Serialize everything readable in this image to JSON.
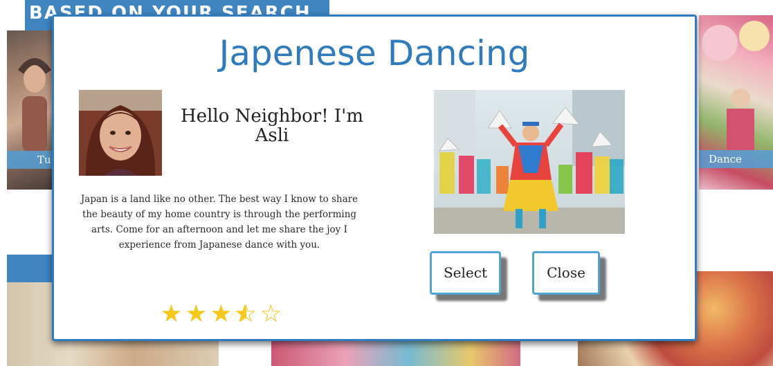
{
  "background": {
    "banner_top": "BASED ON YOUR SEARCH",
    "tile_left_caption": "Tu",
    "tile_right_caption": "Dance"
  },
  "modal": {
    "title": "Japenese Dancing",
    "host": {
      "greeting": "Hello Neighbor! I'm Asli",
      "description": "Japan is a land like no other. The best way I know to share the beauty of my home country is through the performing arts. Come for an afternoon and let me share the joy I experience from Japanese dance with you."
    },
    "rating": {
      "value": 3.5,
      "max": 5,
      "color": "#f6c619"
    },
    "buttons": {
      "select_label": "Select",
      "close_label": "Close"
    }
  },
  "colors": {
    "accent": "#2f7bbd",
    "button_border": "#4ea2d8"
  }
}
